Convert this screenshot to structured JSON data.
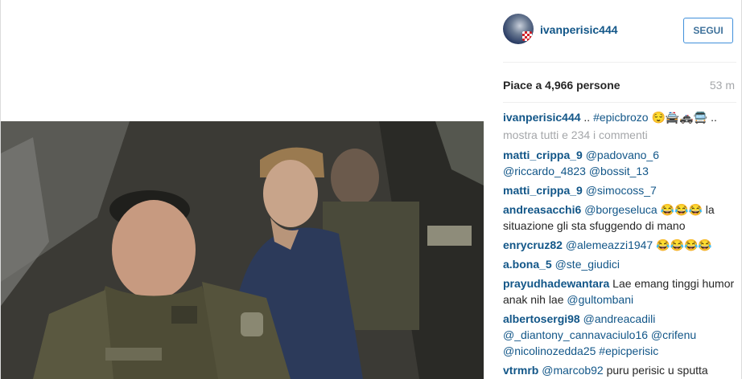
{
  "post": {
    "username": "ivanperisic444",
    "follow_label": "SEGUI",
    "likes": "Piace a 4,966 persone",
    "time": "53 m",
    "photo_alt": "photo"
  },
  "caption": {
    "author": "ivanperisic444",
    "text": " .. ",
    "tag": "#epicbrozo",
    "emoji": " 😌🚔🚓🚍 .."
  },
  "show_all": "mostra tutti e 234 i commenti",
  "comments": [
    {
      "author": "matti_crippa_9",
      "parts": [
        {
          "t": "m",
          "v": "@padovano_6"
        },
        {
          "t": "x",
          "v": " "
        },
        {
          "t": "m",
          "v": "@riccardo_4823"
        },
        {
          "t": "x",
          "v": " "
        },
        {
          "t": "m",
          "v": "@bossit_13"
        }
      ]
    },
    {
      "author": "matti_crippa_9",
      "parts": [
        {
          "t": "m",
          "v": "@simocoss_7"
        }
      ]
    },
    {
      "author": "andreasacchi6",
      "parts": [
        {
          "t": "m",
          "v": "@borgeseluca"
        },
        {
          "t": "x",
          "v": " 😂😂😂 la situazione gli sta sfuggendo di mano"
        }
      ]
    },
    {
      "author": "enrycruz82",
      "parts": [
        {
          "t": "m",
          "v": "@alemeazzi1947"
        },
        {
          "t": "x",
          "v": " 😂😂😂😂"
        }
      ]
    },
    {
      "author": "a.bona_5",
      "parts": [
        {
          "t": "m",
          "v": "@ste_giudici"
        }
      ]
    },
    {
      "author": "prayudhadewantara",
      "parts": [
        {
          "t": "x",
          "v": "Lae emang tinggi humor anak nih lae "
        },
        {
          "t": "m",
          "v": "@gultombani"
        }
      ]
    },
    {
      "author": "albertosergi98",
      "parts": [
        {
          "t": "m",
          "v": "@andreacadili"
        },
        {
          "t": "x",
          "v": " "
        },
        {
          "t": "m",
          "v": "@_diantony_cannavaciulo16"
        },
        {
          "t": "x",
          "v": " "
        },
        {
          "t": "m",
          "v": "@crifenu"
        },
        {
          "t": "x",
          "v": " "
        },
        {
          "t": "m",
          "v": "@nicolinozedda25"
        },
        {
          "t": "x",
          "v": " "
        },
        {
          "t": "m",
          "v": "#epicperisic"
        }
      ]
    },
    {
      "author": "vtrmrb",
      "parts": [
        {
          "t": "m",
          "v": "@marcob92"
        },
        {
          "t": "x",
          "v": " puru perisic u sputta"
        }
      ]
    }
  ]
}
